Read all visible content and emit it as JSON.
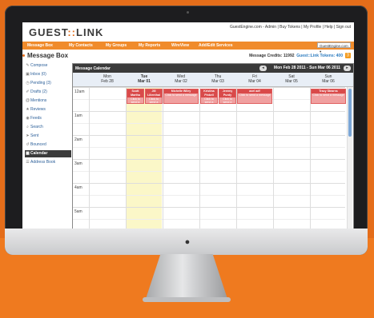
{
  "app": {
    "logo_left": "GUEST",
    "logo_sep": "::",
    "logo_right": "LINK"
  },
  "top_links": "GuestEngine.com - Admin | Buy Tokens | My Profile | Help | Sign out",
  "nav": {
    "items": [
      "Message Box",
      "My Contacts",
      "My Groups",
      "My Reports",
      "WireView",
      "Add/Edit Services"
    ],
    "site_select": "GuestEngine.com"
  },
  "page": {
    "title": "Message Box",
    "credits_label": "Message Credits: 11992",
    "tokens_label": "Guest::Link Tokens: 400"
  },
  "sidebar": {
    "items": [
      {
        "label": "Compose",
        "icon": "pencil-icon"
      },
      {
        "label": "Inbox (0)",
        "icon": "inbox-icon"
      },
      {
        "label": "Pending (3)",
        "icon": "clock-icon"
      },
      {
        "label": "Drafts (2)",
        "icon": "draft-icon"
      },
      {
        "label": "Mentions",
        "icon": "mention-icon"
      },
      {
        "label": "Reviews",
        "icon": "star-icon"
      },
      {
        "label": "Feeds",
        "icon": "rss-icon"
      },
      {
        "label": "Search",
        "icon": "search-icon"
      },
      {
        "label": "Sent",
        "icon": "sent-icon"
      },
      {
        "label": "Bounced",
        "icon": "bounce-icon"
      },
      {
        "label": "Calendar",
        "icon": "calendar-icon",
        "selected": true
      },
      {
        "label": "Address Book",
        "icon": "address-book-icon"
      }
    ]
  },
  "calendar": {
    "title": "Message Calendar",
    "range": "Mon Feb 28 2011 - Sun Mar 06 2011",
    "days": [
      {
        "name": "Mon",
        "date": "Feb 28"
      },
      {
        "name": "Tue",
        "date": "Mar 01",
        "today": true
      },
      {
        "name": "Wed",
        "date": "Mar 02"
      },
      {
        "name": "Thu",
        "date": "Mar 03"
      },
      {
        "name": "Fri",
        "date": "Mar 04"
      },
      {
        "name": "Sat",
        "date": "Mar 05"
      },
      {
        "name": "Sun",
        "date": "Mar 06"
      }
    ],
    "times": [
      "12am",
      "1am",
      "2am",
      "3am",
      "4am",
      "5am"
    ],
    "events": [
      {
        "name": "Scott Martha",
        "text": "Click to send a message",
        "day": 1,
        "slot": 0
      },
      {
        "name": "Jill Lilienthal",
        "text": "Click to send a",
        "day": 1,
        "slot": 1
      },
      {
        "name": "Michelle Wiley",
        "text": "Click to send a message",
        "day": 2,
        "slot": 0
      },
      {
        "name": "Kristina Pinkell",
        "text": "Click to send a",
        "day": 3,
        "slot": 0
      },
      {
        "name": "Jeremy Purdy",
        "text": "Click to send a",
        "day": 3,
        "slot": 1
      },
      {
        "name": "axel adf",
        "text": "Click to send a message",
        "day": 4,
        "slot": 0
      },
      {
        "name": "Tracy Stearns",
        "text": "Click to send a message",
        "day": 6,
        "slot": 0
      }
    ]
  },
  "colors": {
    "brand": "#e46d1a",
    "event": "#d94a4a",
    "today": "#fbf7c8"
  }
}
